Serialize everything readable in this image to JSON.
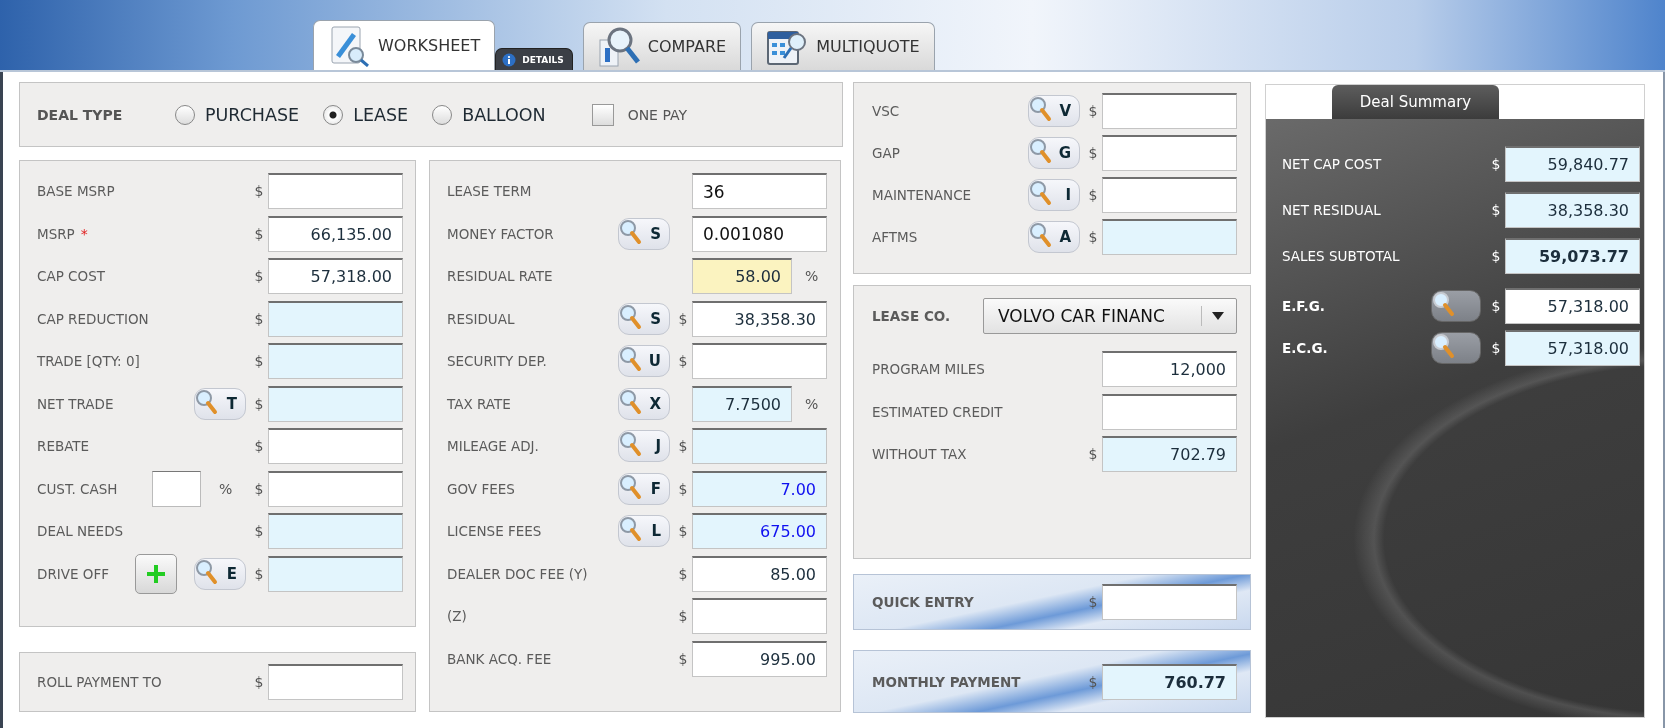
{
  "tabs": [
    {
      "label": "WORKSHEET",
      "kind": "main",
      "selected": true
    },
    {
      "label": "DETAILS",
      "kind": "sub",
      "selected": false
    },
    {
      "label": "COMPARE",
      "kind": "main",
      "selected": false
    },
    {
      "label": "MULTIQUOTE",
      "kind": "main",
      "selected": false
    }
  ],
  "deal_type": {
    "label": "DEAL TYPE",
    "options": [
      {
        "label": "PURCHASE",
        "selected": false
      },
      {
        "label": "LEASE",
        "selected": true
      },
      {
        "label": "BALLOON",
        "selected": false
      }
    ],
    "one_pay": {
      "label": "ONE PAY",
      "checked": false
    }
  },
  "price_panel": {
    "rows": [
      {
        "label": "BASE MSRP",
        "currency": "$",
        "readonly": false
      },
      {
        "label": "MSRP",
        "marker": "*",
        "currency": "$",
        "value": "66,135.00",
        "readonly": false
      },
      {
        "label": "CAP COST",
        "currency": "$",
        "value": "57,318.00",
        "readonly": false
      },
      {
        "label": "CAP REDUCTION",
        "currency": "$",
        "readonly": true
      },
      {
        "label": "TRADE [QTY: 0]",
        "currency": "$",
        "readonly": true
      },
      {
        "label": "NET TRADE",
        "lookup": "T",
        "currency": "$",
        "readonly": true
      },
      {
        "label": "REBATE",
        "currency": "$",
        "readonly": false
      },
      {
        "label": "CUST. CASH",
        "percent_input": {
          "unit": "%"
        },
        "currency": "$",
        "readonly": false
      },
      {
        "label": "DEAL NEEDS",
        "currency": "$",
        "readonly": true
      },
      {
        "label": "DRIVE OFF",
        "add_button": true,
        "lookup": "E",
        "currency": "$",
        "readonly": true
      }
    ]
  },
  "roll_panel": {
    "rows": [
      {
        "label": "ROLL PAYMENT TO",
        "currency": "$",
        "readonly": false
      }
    ]
  },
  "lease_panel": {
    "rows": [
      {
        "label": "LEASE TERM",
        "value": "36",
        "left_aligned": true,
        "readonly": false,
        "attention": false,
        "highlight": false
      },
      {
        "label": "MONEY FACTOR",
        "lookup": "S",
        "value": "0.001080",
        "left_aligned": true,
        "readonly": false,
        "attention": false,
        "highlight": false
      },
      {
        "label": "RESIDUAL RATE",
        "value": "58.00",
        "unit": "%",
        "readonly": false,
        "attention": true,
        "highlight": false
      },
      {
        "label": "RESIDUAL",
        "lookup": "S",
        "currency": "$",
        "value": "38,358.30",
        "readonly": false,
        "attention": false,
        "highlight": false
      },
      {
        "label": "SECURITY DEP.",
        "lookup": "U",
        "currency": "$",
        "readonly": false,
        "attention": false
      },
      {
        "label": "TAX RATE",
        "lookup": "X",
        "value": "7.7500",
        "unit": "%",
        "readonly": true,
        "attention": false,
        "highlight": false
      },
      {
        "label": "MILEAGE ADJ.",
        "lookup": "J",
        "currency": "$",
        "readonly": true,
        "attention": false
      },
      {
        "label": "GOV FEES",
        "lookup": "F",
        "currency": "$",
        "value": "7.00",
        "readonly": true,
        "attention": false,
        "highlight": true
      },
      {
        "label": "LICENSE FEES",
        "lookup": "L",
        "currency": "$",
        "value": "675.00",
        "readonly": true,
        "attention": false,
        "highlight": true
      },
      {
        "label": "DEALER DOC FEE (Y)",
        "currency": "$",
        "value": "85.00",
        "readonly": false,
        "attention": false,
        "highlight": false
      },
      {
        "label": "(Z)",
        "currency": "$",
        "readonly": false,
        "attention": false
      },
      {
        "label": "BANK ACQ. FEE",
        "currency": "$",
        "value": "995.00",
        "readonly": false,
        "attention": false,
        "highlight": false
      }
    ]
  },
  "products_panel": {
    "rows": [
      {
        "label": "VSC",
        "lookup": "V",
        "currency": "$",
        "readonly": false
      },
      {
        "label": "GAP",
        "lookup": "G",
        "currency": "$",
        "readonly": false
      },
      {
        "label": "MAINTENANCE",
        "lookup": "I",
        "currency": "$",
        "readonly": false
      },
      {
        "label": "AFTMS",
        "lookup": "A",
        "currency": "$",
        "readonly": true
      }
    ]
  },
  "lease_company": {
    "label": "LEASE CO.",
    "value": "VOLVO CAR FINANC",
    "rows": [
      {
        "label": "PROGRAM MILES",
        "value": "12,000",
        "readonly": false
      },
      {
        "label": "ESTIMATED CREDIT",
        "readonly": false
      },
      {
        "label": "WITHOUT TAX",
        "currency": "$",
        "value": "702.79",
        "readonly": true
      }
    ]
  },
  "quick_entry": {
    "label": "QUICK ENTRY",
    "currency": "$",
    "readonly": false
  },
  "monthly_payment": {
    "label": "MONTHLY PAYMENT",
    "currency": "$",
    "value": "760.77",
    "readonly": true,
    "bold_value": true
  },
  "deal_summary": {
    "title": "Deal Summary",
    "rows": [
      {
        "label": "NET CAP COST",
        "currency": "$",
        "value": "59,840.77",
        "readonly": true,
        "bold_label": false,
        "bold_value": false
      },
      {
        "label": "NET RESIDUAL",
        "currency": "$",
        "value": "38,358.30",
        "readonly": true,
        "bold_label": false,
        "bold_value": false
      },
      {
        "label": "SALES SUBTOTAL",
        "currency": "$",
        "value": "59,073.77",
        "readonly": true,
        "bold_label": false,
        "bold_value": true
      },
      {
        "label": "E.F.G.",
        "lookup_toggle": true,
        "currency": "$",
        "value": "57,318.00",
        "readonly": false,
        "bold_label": true,
        "bold_value": false
      },
      {
        "label": "E.C.G.",
        "lookup_toggle": true,
        "currency": "$",
        "value": "57,318.00",
        "readonly": true,
        "bold_label": true,
        "bold_value": false
      }
    ]
  }
}
